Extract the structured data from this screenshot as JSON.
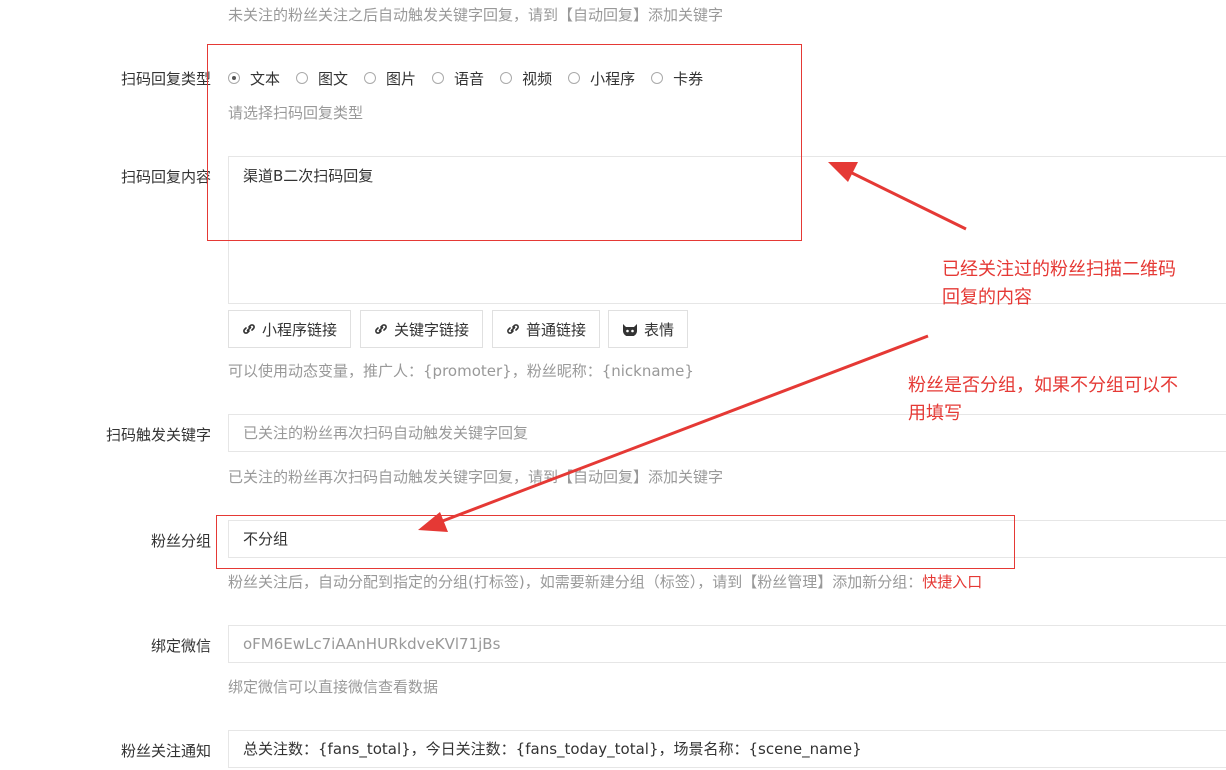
{
  "top_help": "未关注的粉丝关注之后自动触发关键字回复，请到【自动回复】添加关键字",
  "reply_type": {
    "label": "扫码回复类型",
    "options": [
      "文本",
      "图文",
      "图片",
      "语音",
      "视频",
      "小程序",
      "卡券"
    ],
    "selected": "文本",
    "help": "请选择扫码回复类型"
  },
  "reply_content": {
    "label": "扫码回复内容",
    "value": "渠道B二次扫码回复",
    "buttons": [
      "小程序链接",
      "关键字链接",
      "普通链接",
      "表情"
    ],
    "help": "可以使用动态变量，推广人：{promoter}，粉丝昵称：{nickname}"
  },
  "trigger_keyword": {
    "label": "扫码触发关键字",
    "placeholder": "已关注的粉丝再次扫码自动触发关键字回复",
    "help": "已关注的粉丝再次扫码自动触发关键字回复，请到【自动回复】添加关键字"
  },
  "fan_group": {
    "label": "粉丝分组",
    "value": "不分组",
    "help": "粉丝关注后，自动分配到指定的分组(打标签)，如需要新建分组（标签），请到【粉丝管理】添加新分组：",
    "shortcut_link": "快捷入口"
  },
  "bind_wechat": {
    "label": "绑定微信",
    "placeholder": "oFM6EwLc7iAAnHURkdveKVl71jBs",
    "help": "绑定微信可以直接微信查看数据"
  },
  "follow_notice": {
    "label": "粉丝关注通知",
    "value": "总关注数：{fans_total}，今日关注数：{fans_today_total}，场景名称：{scene_name}"
  },
  "annotations": {
    "note1_line1": "已经关注过的粉丝扫描二维码",
    "note1_line2": "回复的内容",
    "note2_line1": "粉丝是否分组，如果不分组可以不",
    "note2_line2": "用填写"
  },
  "colors": {
    "annotation": "#e53935",
    "help_text": "#999999",
    "border": "#e6e6e6"
  }
}
